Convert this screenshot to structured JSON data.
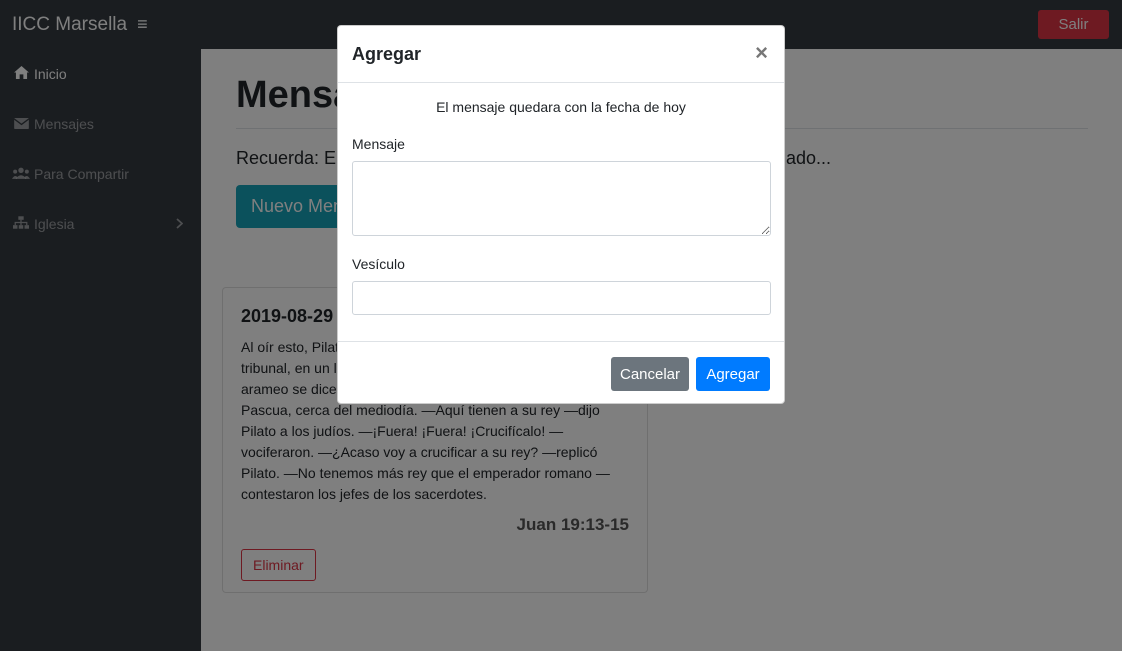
{
  "app": {
    "brand": "IICC Marsella",
    "menu_icon": "≡",
    "logout_label": "Salir"
  },
  "sidebar": {
    "items": [
      {
        "label": "Inicio",
        "icon": "home-icon"
      },
      {
        "label": "Mensajes",
        "icon": "envelope-icon"
      },
      {
        "label": "Para Compartir",
        "icon": "users-icon"
      },
      {
        "label": "Iglesia",
        "icon": "sitemap-icon"
      }
    ]
  },
  "main": {
    "title": "Mensajes",
    "reminder": "Recuerda: En",
    "reminder_tail": "ado...",
    "new_button": "Nuevo Mensaje"
  },
  "card": {
    "date": "2019-08-29",
    "text": "Al oír esto, Pilato llevó a Jesús hacia fuera y se sentó en el tribunal, en un lugar al que llamaban el Empedrado (que en arameo se dice Gabatá). Era el día de la preparación para la Pascua, cerca del mediodía. —Aquí tienen a su rey —dijo Pilato a los judíos. —¡Fuera! ¡Fuera! ¡Crucifícalo! —vociferaron. —¿Acaso voy a crucificar a su rey? —replicó Pilato. —No tenemos más rey que el emperador romano —contestaron los jefes de los sacerdotes.",
    "reference": "Juan 19:13-15",
    "delete_label": "Eliminar"
  },
  "modal": {
    "title": "Agregar",
    "close": "×",
    "note": "El mensaje quedara con la fecha de hoy",
    "message_label": "Mensaje",
    "message_value": "",
    "verse_label": "Vesículo",
    "verse_value": "",
    "cancel_label": "Cancelar",
    "submit_label": "Agregar"
  },
  "colors": {
    "navbar": "#343a40",
    "danger": "#dc3545",
    "info": "#17a2b8",
    "primary": "#007bff",
    "secondary": "#6c757d"
  }
}
